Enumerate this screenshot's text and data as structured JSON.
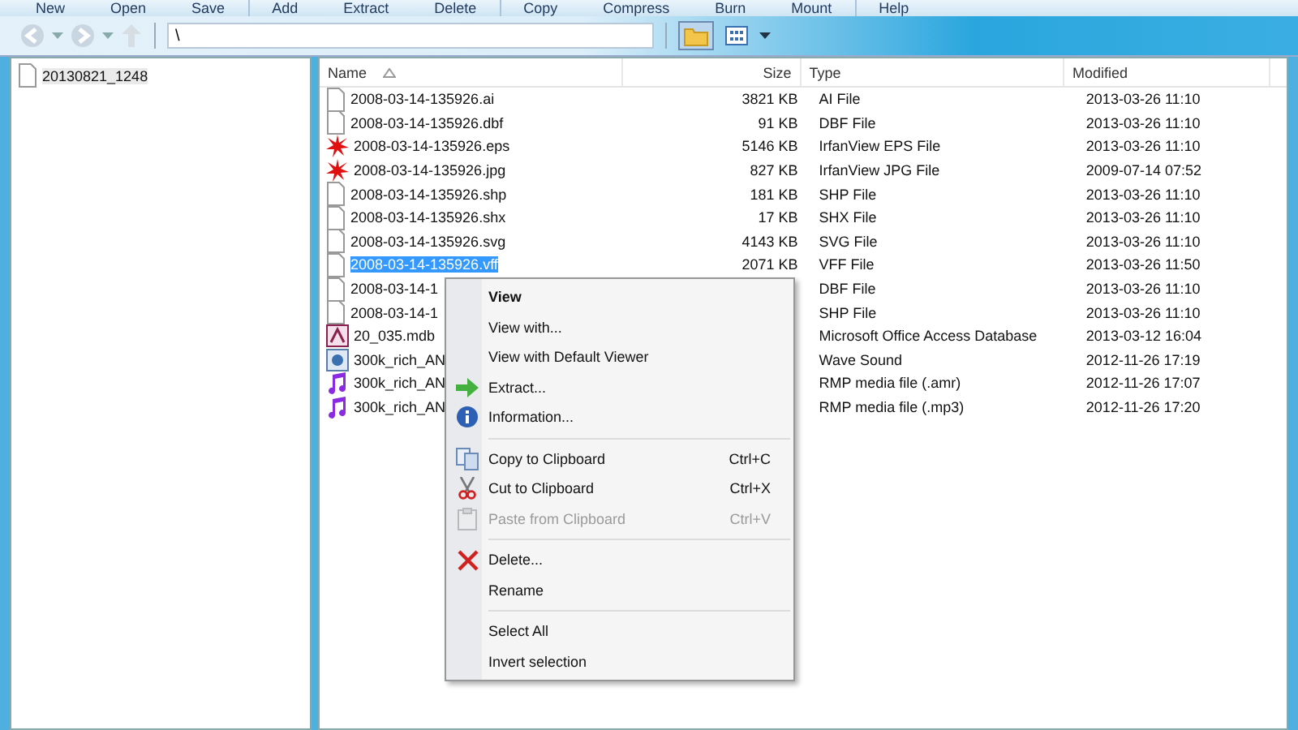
{
  "toolbar": {
    "groups": [
      [
        "New",
        "Open",
        "Save"
      ],
      [
        "Add",
        "Extract",
        "Delete"
      ],
      [
        "Copy",
        "Compress",
        "Burn",
        "Mount"
      ],
      [
        "Help"
      ]
    ]
  },
  "address": {
    "value": "\\"
  },
  "tree": [
    {
      "label": "20130821_1248",
      "selected": true
    }
  ],
  "table": {
    "columns": [
      "Name",
      "Size",
      "Type",
      "Modified"
    ],
    "rows": [
      {
        "kind": "file",
        "name": "2008-03-14-135926.ai",
        "size": "3821 KB",
        "type": "AI File",
        "modified": "2013-03-26 11:10",
        "selected": false
      },
      {
        "kind": "file",
        "name": "2008-03-14-135926.dbf",
        "size": "91 KB",
        "type": "DBF File",
        "modified": "2013-03-26 11:10",
        "selected": false
      },
      {
        "kind": "irfan",
        "name": "2008-03-14-135926.eps",
        "size": "5146 KB",
        "type": "IrfanView EPS File",
        "modified": "2013-03-26 11:10",
        "selected": false
      },
      {
        "kind": "irfan",
        "name": "2008-03-14-135926.jpg",
        "size": "827 KB",
        "type": "IrfanView JPG File",
        "modified": "2009-07-14 07:52",
        "selected": false
      },
      {
        "kind": "file",
        "name": "2008-03-14-135926.shp",
        "size": "181 KB",
        "type": "SHP File",
        "modified": "2013-03-26 11:10",
        "selected": false
      },
      {
        "kind": "file",
        "name": "2008-03-14-135926.shx",
        "size": "17 KB",
        "type": "SHX File",
        "modified": "2013-03-26 11:10",
        "selected": false
      },
      {
        "kind": "file",
        "name": "2008-03-14-135926.svg",
        "size": "4143 KB",
        "type": "SVG File",
        "modified": "2013-03-26 11:10",
        "selected": false
      },
      {
        "kind": "file",
        "name": "2008-03-14-135926.vff",
        "size": "2071 KB",
        "type": "VFF File",
        "modified": "2013-03-26 11:50",
        "selected": true
      },
      {
        "kind": "file",
        "name": "2008-03-14-1",
        "type": "DBF File",
        "modified": "2013-03-26 11:10",
        "selected": false
      },
      {
        "kind": "file",
        "name": "2008-03-14-1",
        "type": "SHP File",
        "modified": "2013-03-26 11:10",
        "selected": false
      },
      {
        "kind": "access",
        "name": "20_035.mdb",
        "type": "Microsoft Office Access Database",
        "modified": "2013-03-12 16:04",
        "selected": false
      },
      {
        "kind": "wave",
        "name": "300k_rich_AN",
        "type": "Wave Sound",
        "modified": "2012-11-26 17:19",
        "selected": false
      },
      {
        "kind": "media",
        "name": "300k_rich_AN",
        "type": "RMP media file (.amr)",
        "modified": "2012-11-26 17:07",
        "selected": false
      },
      {
        "kind": "media",
        "name": "300k_rich_AN",
        "type": "RMP media file (.mp3)",
        "modified": "2012-11-26 17:20",
        "selected": false
      }
    ]
  },
  "context_menu": [
    {
      "kind": "plain",
      "label": "View",
      "default": true,
      "disabled": false
    },
    {
      "kind": "plain",
      "label": "View with...",
      "default": false,
      "disabled": false
    },
    {
      "kind": "plain",
      "label": "View with Default Viewer",
      "default": false,
      "disabled": false
    },
    {
      "kind": "extract",
      "label": "Extract...",
      "default": false,
      "disabled": false
    },
    {
      "kind": "info",
      "label": "Information...",
      "default": false,
      "disabled": false
    },
    {
      "kind": "separator"
    },
    {
      "kind": "copy",
      "label": "Copy to Clipboard",
      "shortcut": "Ctrl+C",
      "default": false,
      "disabled": false
    },
    {
      "kind": "cut",
      "label": "Cut to Clipboard",
      "shortcut": "Ctrl+X",
      "default": false,
      "disabled": false
    },
    {
      "kind": "paste",
      "label": "Paste from Clipboard",
      "shortcut": "Ctrl+V",
      "default": false,
      "disabled": true
    },
    {
      "kind": "separator"
    },
    {
      "kind": "delete",
      "label": "Delete...",
      "default": false,
      "disabled": false
    },
    {
      "kind": "plain",
      "label": "Rename",
      "default": false,
      "disabled": false
    },
    {
      "kind": "separator"
    },
    {
      "kind": "plain",
      "label": "Select All",
      "default": false,
      "disabled": false
    },
    {
      "kind": "plain",
      "label": "Invert selection",
      "default": false,
      "disabled": false
    }
  ]
}
